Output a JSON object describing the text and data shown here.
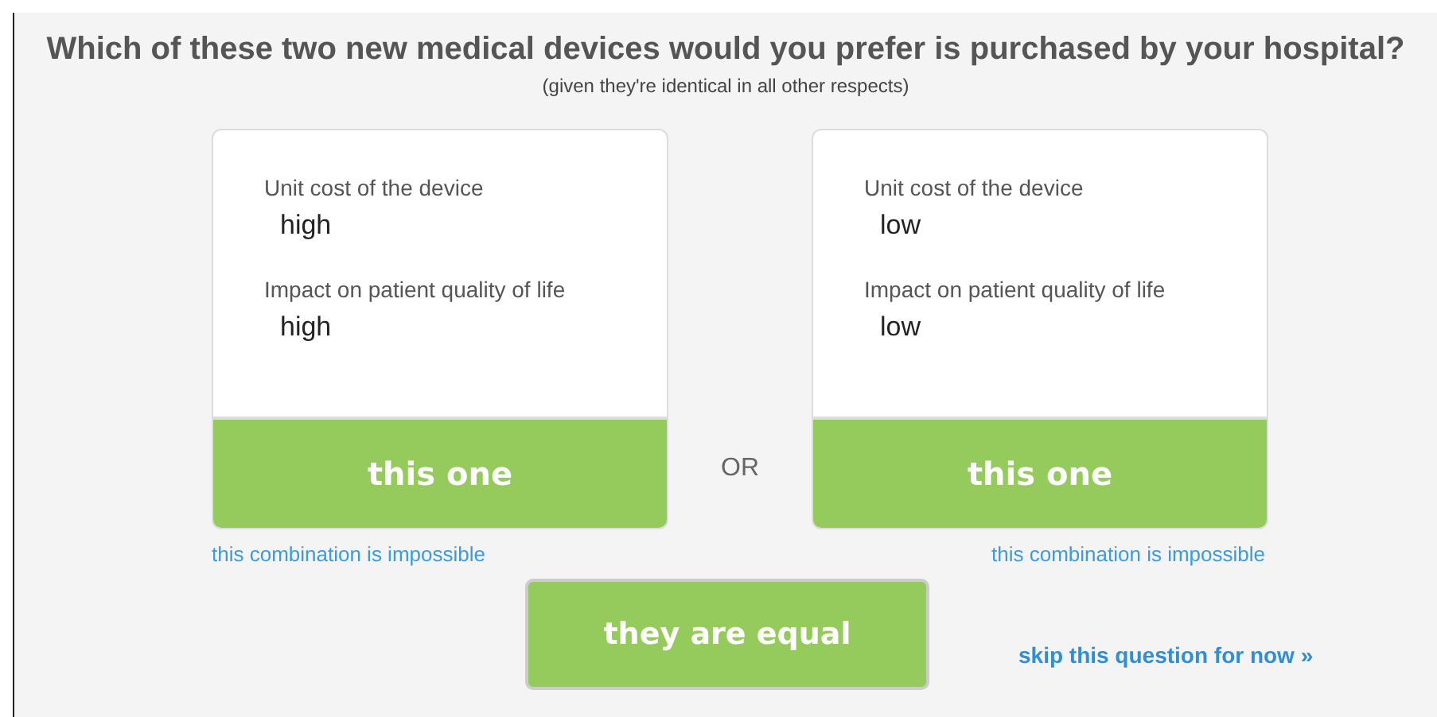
{
  "question": "Which of these two new medical devices would you prefer is purchased by your hospital?",
  "subtitle": "(given they're identical in all other respects)",
  "options": [
    {
      "attributes": [
        {
          "label": "Unit cost of the device",
          "value": "high"
        },
        {
          "label": "Impact on patient quality of life",
          "value": "high"
        }
      ],
      "button": "this one",
      "impossible_link": "this combination is impossible"
    },
    {
      "attributes": [
        {
          "label": "Unit cost of the device",
          "value": "low"
        },
        {
          "label": "Impact on patient quality of life",
          "value": "low"
        }
      ],
      "button": "this one",
      "impossible_link": "this combination is impossible"
    }
  ],
  "separator": "OR",
  "equal_button": "they are equal",
  "skip_link": "skip this question for now »"
}
